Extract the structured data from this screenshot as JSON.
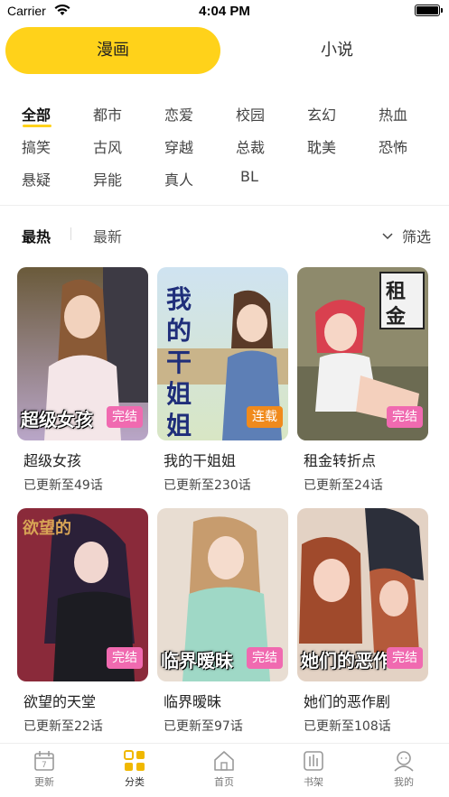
{
  "status_bar": {
    "carrier": "Carrier",
    "time": "4:04 PM"
  },
  "main_tabs": [
    {
      "label": "漫画",
      "active": true
    },
    {
      "label": "小说",
      "active": false
    }
  ],
  "genres": [
    {
      "label": "全部",
      "active": true
    },
    {
      "label": "都市"
    },
    {
      "label": "恋爱"
    },
    {
      "label": "校园"
    },
    {
      "label": "玄幻"
    },
    {
      "label": "热血"
    },
    {
      "label": "搞笑"
    },
    {
      "label": "古风"
    },
    {
      "label": "穿越"
    },
    {
      "label": "总裁"
    },
    {
      "label": "耽美"
    },
    {
      "label": "恐怖"
    },
    {
      "label": "悬疑"
    },
    {
      "label": "异能"
    },
    {
      "label": "真人"
    },
    {
      "label": "BL"
    }
  ],
  "sort": {
    "hot": "最热",
    "new": "最新",
    "filter": "筛选"
  },
  "comics": [
    {
      "title": "超级女孩",
      "updated": "已更新至49话",
      "badge": "完结",
      "cover_text": "超级女孩",
      "badge_color": "#f06ab0"
    },
    {
      "title": "我的干姐姐",
      "updated": "已更新至230话",
      "badge": "连载",
      "cover_text": "我的干姐姐",
      "badge_color": "#f08a1c"
    },
    {
      "title": "租金转折点",
      "updated": "已更新至24话",
      "badge": "完结",
      "cover_text": "租金转折点",
      "badge_color": "#f06ab0"
    },
    {
      "title": "欲望的天堂",
      "updated": "已更新至22话",
      "badge": "完结",
      "cover_text": "欲望的天堂",
      "badge_color": "#f06ab0"
    },
    {
      "title": "临界暧昧",
      "updated": "已更新至97话",
      "badge": "完结",
      "cover_text": "临界暧昧",
      "badge_color": "#f06ab0"
    },
    {
      "title": "她们的恶作剧",
      "updated": "已更新至108话",
      "badge": "完结",
      "cover_text": "她们的恶作",
      "badge_color": "#f06ab0"
    }
  ],
  "tabbar": [
    {
      "label": "更新",
      "icon": "calendar-icon"
    },
    {
      "label": "分类",
      "icon": "category-icon",
      "active": true
    },
    {
      "label": "首页",
      "icon": "home-icon"
    },
    {
      "label": "书架",
      "icon": "bookshelf-icon"
    },
    {
      "label": "我的",
      "icon": "profile-icon"
    }
  ],
  "colors": {
    "accent": "#ffd21a",
    "badge_done": "#f06ab0",
    "badge_ongoing": "#f08a1c"
  }
}
